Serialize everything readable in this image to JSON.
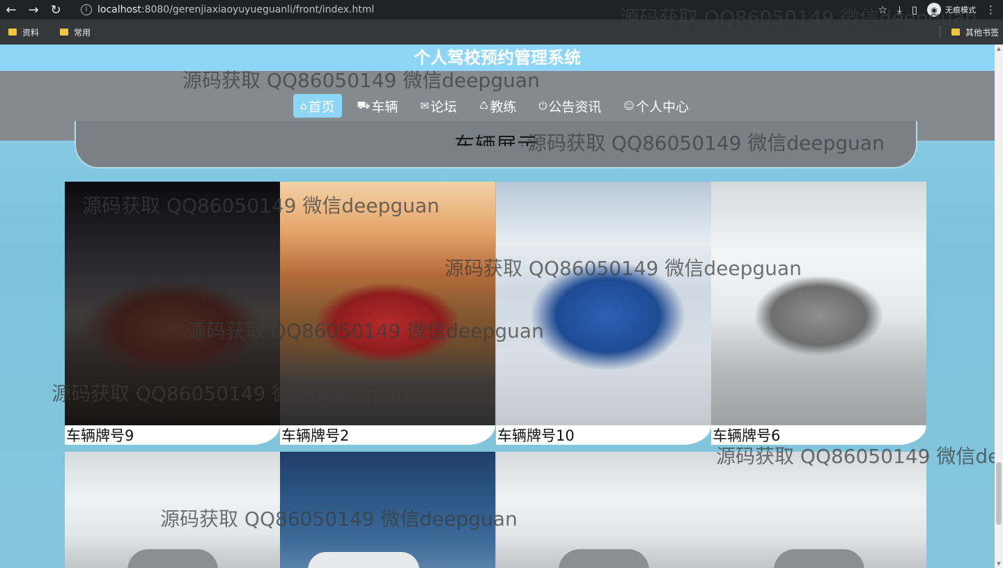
{
  "browser": {
    "url_host": "localhost",
    "url_rest": ":8080/gerenjiaxiaoyuyueguanli/front/index.html",
    "incognito_label": "无痕模式",
    "bookmarks": [
      "资料",
      "常用"
    ],
    "other_bookmarks": "其他书签"
  },
  "site": {
    "title": "个人驾校预约管理系统",
    "menu": [
      {
        "label": "首页",
        "icon": "home-icon",
        "glyph": "⌂",
        "active": true
      },
      {
        "label": "车辆",
        "icon": "car-icon",
        "glyph": "⛟",
        "active": false
      },
      {
        "label": "论坛",
        "icon": "mail-icon",
        "glyph": "✉",
        "active": false
      },
      {
        "label": "教练",
        "icon": "coach-icon",
        "glyph": "♺",
        "active": false
      },
      {
        "label": "公告资讯",
        "icon": "power-icon",
        "glyph": "⏻",
        "active": false
      },
      {
        "label": "个人中心",
        "icon": "user-icon",
        "glyph": "☺",
        "active": false
      }
    ],
    "section_title": "车辆展示"
  },
  "cars": [
    {
      "plate": "车辆牌号9"
    },
    {
      "plate": "车辆牌号2"
    },
    {
      "plate": "车辆牌号10"
    },
    {
      "plate": "车辆牌号6"
    }
  ],
  "watermark": "源码获取 QQ86050149 微信deepguan"
}
